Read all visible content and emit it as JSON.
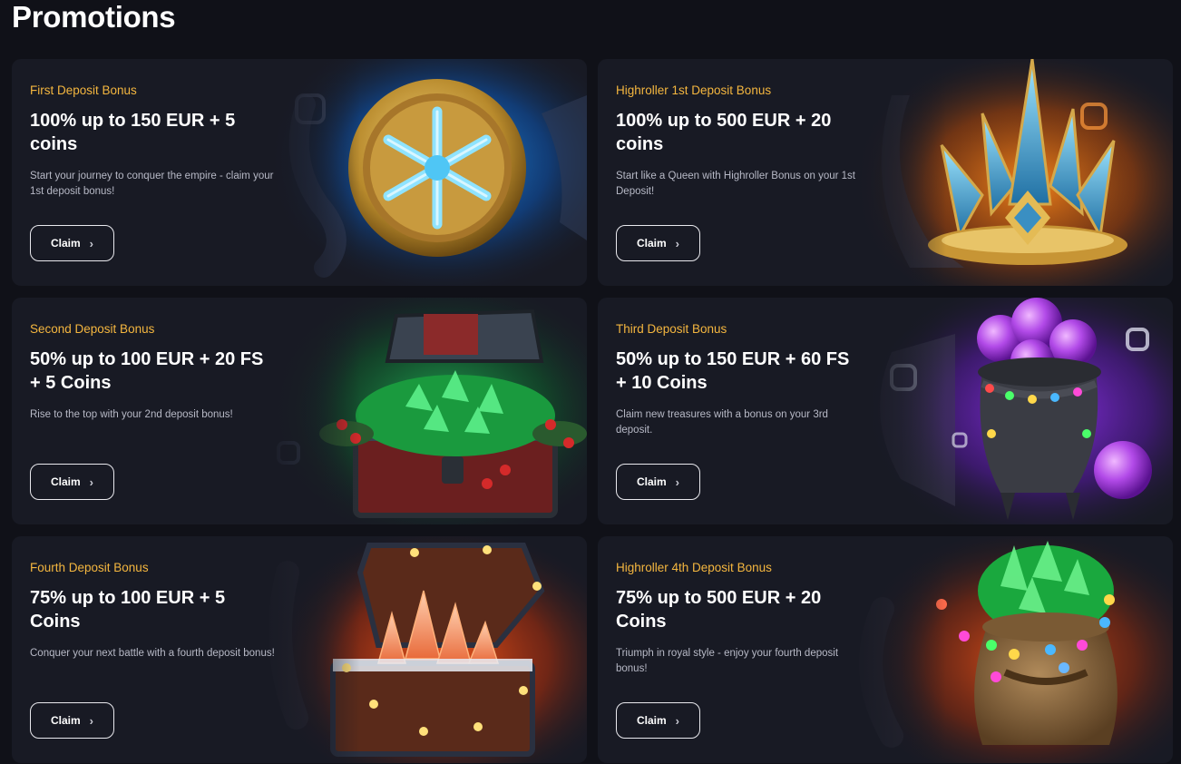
{
  "page": {
    "title": "Promotions"
  },
  "promotions": [
    {
      "subtitle": "First Deposit Bonus",
      "title": "100% up to 150 EUR + 5 coins",
      "description": "Start your journey to conquer the empire - claim your 1st deposit bonus!",
      "button_label": "Claim",
      "image_icon": "snowflake-coin-icon",
      "glow_color": "#1f8ff0"
    },
    {
      "subtitle": "Highroller 1st Deposit Bonus",
      "title": "100% up to 500 EUR + 20 coins",
      "description": "Start like a Queen with Highroller Bonus on your 1st Deposit!",
      "button_label": "Claim",
      "image_icon": "ice-crown-icon",
      "glow_color": "#f07a10"
    },
    {
      "subtitle": "Second Deposit Bonus",
      "title": "50% up to 100 EUR + 20 FS + 5 Coins",
      "description": "Rise to the top with your 2nd deposit bonus!",
      "button_label": "Claim",
      "image_icon": "emerald-treasure-chest-icon",
      "glow_color": "#1aa84a"
    },
    {
      "subtitle": "Third Deposit Bonus",
      "title": "50% up to 150 EUR + 60 FS + 10 Coins",
      "description": "Claim new treasures with a bonus on your 3rd deposit.",
      "button_label": "Claim",
      "image_icon": "cauldron-orbs-icon",
      "glow_color": "#8b2ee8"
    },
    {
      "subtitle": "Fourth Deposit Bonus",
      "title": "75% up to 100 EUR + 5 Coins",
      "description": "Conquer your next battle with a fourth deposit bonus!",
      "button_label": "Claim",
      "image_icon": "crystal-treasure-chest-icon",
      "glow_color": "#f04a10"
    },
    {
      "subtitle": "Highroller 4th Deposit Bonus",
      "title": "75% up to 500 EUR + 20 Coins",
      "description": "Triumph in royal style - enjoy your fourth deposit bonus!",
      "button_label": "Claim",
      "image_icon": "emerald-sack-icon",
      "glow_color": "#e8501a"
    }
  ],
  "colors": {
    "background": "#101118",
    "card": "#181a24",
    "accent": "#f4b63f"
  }
}
